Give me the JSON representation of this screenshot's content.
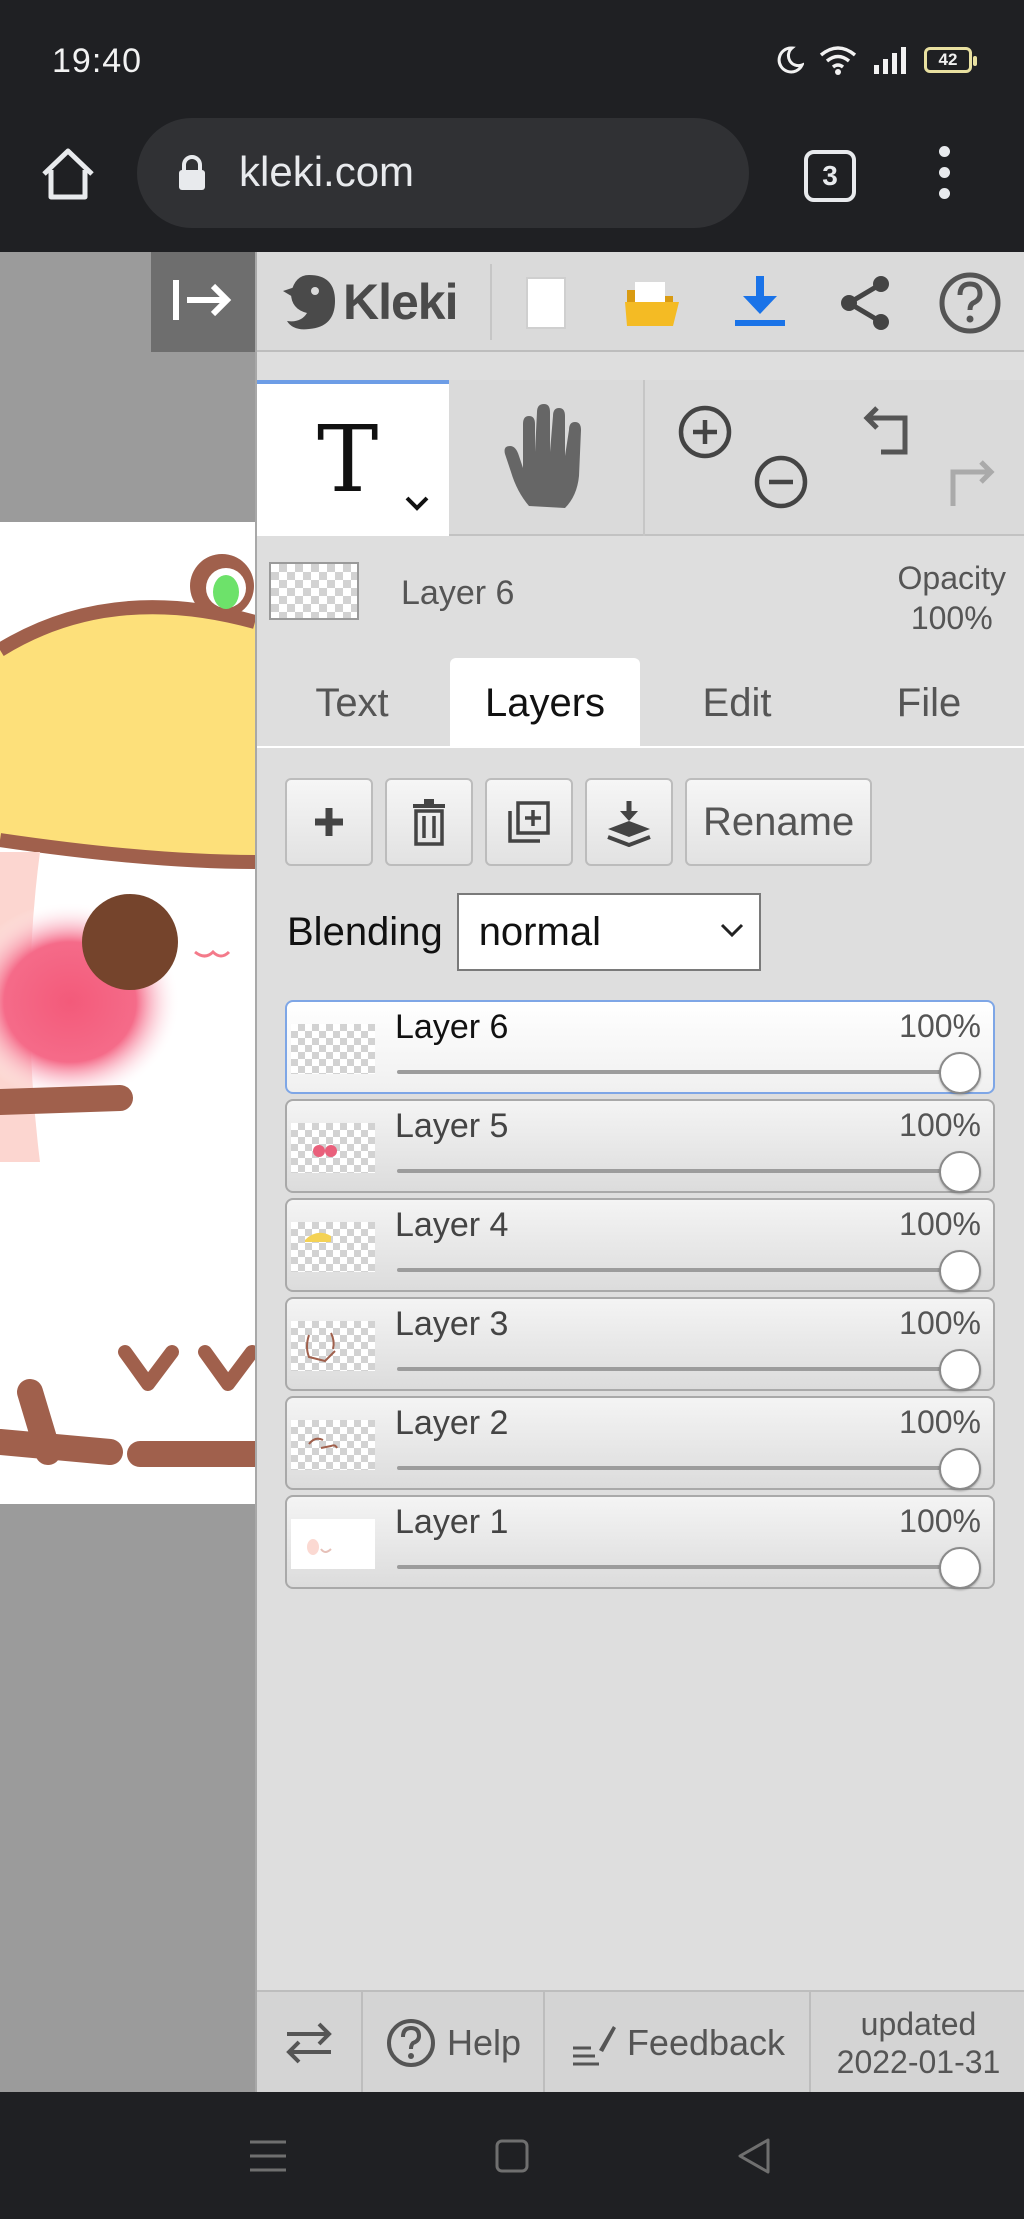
{
  "status": {
    "time": "19:40",
    "battery": "42"
  },
  "browser": {
    "url": "kleki.com",
    "tab_count": "3"
  },
  "app": {
    "brand": "Kleki",
    "current_layer": {
      "name": "Layer 6",
      "opacity_label": "Opacity",
      "opacity_value": "100%"
    },
    "tool_text_glyph": "T",
    "tabs": [
      {
        "label": "Text"
      },
      {
        "label": "Layers"
      },
      {
        "label": "Edit"
      },
      {
        "label": "File"
      }
    ],
    "active_tab": "Layers",
    "actions": {
      "rename": "Rename"
    },
    "blending": {
      "label": "Blending",
      "value": "normal"
    },
    "layers": [
      {
        "name": "Layer 6",
        "opacity": "100%"
      },
      {
        "name": "Layer 5",
        "opacity": "100%"
      },
      {
        "name": "Layer 4",
        "opacity": "100%"
      },
      {
        "name": "Layer 3",
        "opacity": "100%"
      },
      {
        "name": "Layer 2",
        "opacity": "100%"
      },
      {
        "name": "Layer 1",
        "opacity": "100%"
      }
    ],
    "footer": {
      "help": "Help",
      "feedback": "Feedback",
      "updated_label": "updated",
      "updated_date": "2022-01-31"
    }
  },
  "colors": {
    "accent": "#6d9de6",
    "download": "#1a73e8",
    "folder": "#f2b824",
    "panel": "#dedede"
  }
}
